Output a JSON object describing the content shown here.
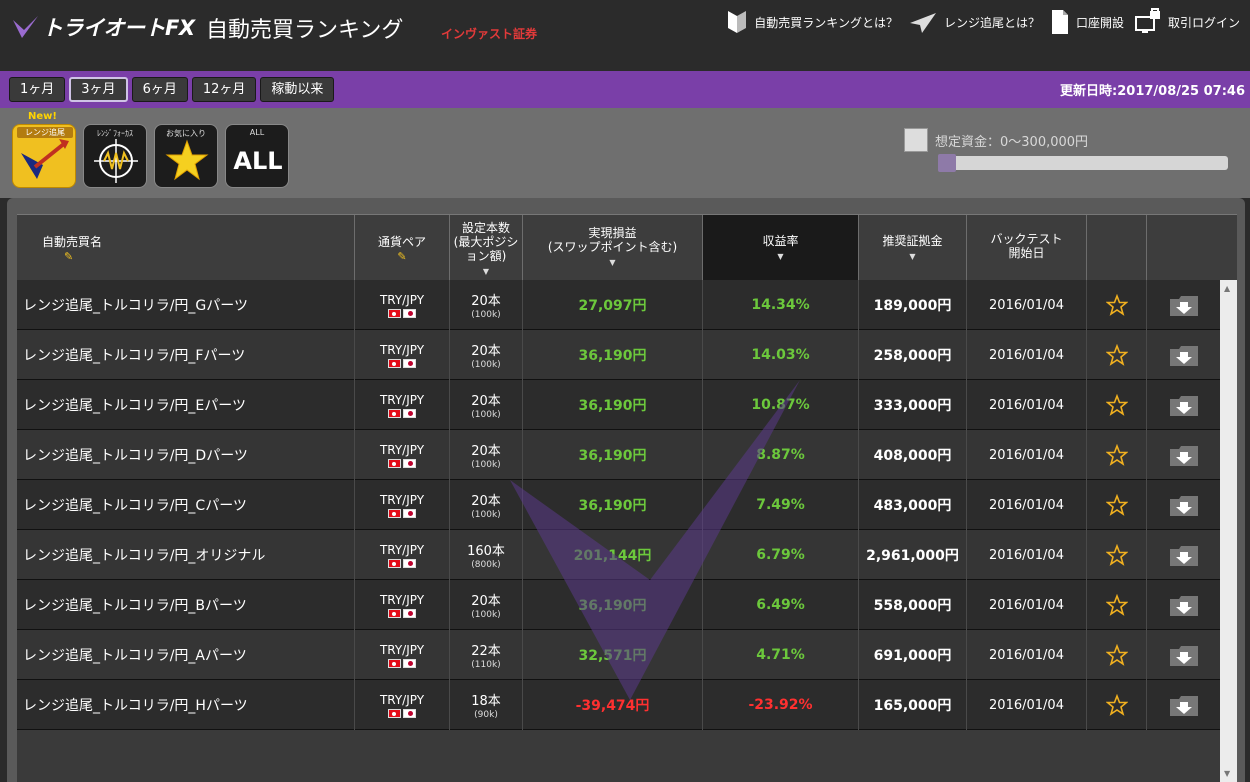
{
  "header": {
    "logo_text": "トライオートFX",
    "title": "自動売買ランキング",
    "broker": "インヴァスト証券",
    "nav": [
      {
        "label": "自動売買ランキングとは？"
      },
      {
        "label": "レンジ追尾とは？"
      },
      {
        "label": "口座開設"
      },
      {
        "label": "取引ログイン"
      }
    ]
  },
  "periods": [
    "1ヶ月",
    "3ヶ月",
    "6ヶ月",
    "12ヶ月",
    "稼動以来"
  ],
  "selected_period": "3ヶ月",
  "updated_at": "更新日時:2017/08/25 07:46",
  "categories": [
    {
      "caption": "レンジ追尾",
      "badge": "New!",
      "icon": "range-trail-icon",
      "active": true
    },
    {
      "caption": "ﾚﾝｼﾞﾌｫｰｶｽ",
      "icon": "range-focus-icon"
    },
    {
      "caption": "お気に入り",
      "icon": "star-icon"
    },
    {
      "caption": "ALL",
      "label": "ALL",
      "icon": "all-icon"
    }
  ],
  "fund_filter": {
    "label": "想定資金：0～300,000円"
  },
  "columns": {
    "name": "自動売買名",
    "pair": "通貨ペア",
    "count_l1": "設定本数",
    "count_l2": "(最大ポジシ",
    "count_l3": "ョン額)",
    "pnl_l1": "実現損益",
    "pnl_l2": "(スワップポイント含む)",
    "rate": "収益率",
    "margin": "推奨証拠金",
    "bt_l1": "バックテスト",
    "bt_l2": "開始日"
  },
  "rows": [
    {
      "name": "レンジ追尾_トルコリラ/円_Gパーツ",
      "pair": "TRY/JPY",
      "count": "20本",
      "max": "(100k)",
      "pnl": "27,097円",
      "rate": "14.34%",
      "margin": "189,000円",
      "date": "2016/01/04",
      "neg": false
    },
    {
      "name": "レンジ追尾_トルコリラ/円_Fパーツ",
      "pair": "TRY/JPY",
      "count": "20本",
      "max": "(100k)",
      "pnl": "36,190円",
      "rate": "14.03%",
      "margin": "258,000円",
      "date": "2016/01/04",
      "neg": false
    },
    {
      "name": "レンジ追尾_トルコリラ/円_Eパーツ",
      "pair": "TRY/JPY",
      "count": "20本",
      "max": "(100k)",
      "pnl": "36,190円",
      "rate": "10.87%",
      "margin": "333,000円",
      "date": "2016/01/04",
      "neg": false
    },
    {
      "name": "レンジ追尾_トルコリラ/円_Dパーツ",
      "pair": "TRY/JPY",
      "count": "20本",
      "max": "(100k)",
      "pnl": "36,190円",
      "rate": "8.87%",
      "margin": "408,000円",
      "date": "2016/01/04",
      "neg": false
    },
    {
      "name": "レンジ追尾_トルコリラ/円_Cパーツ",
      "pair": "TRY/JPY",
      "count": "20本",
      "max": "(100k)",
      "pnl": "36,190円",
      "rate": "7.49%",
      "margin": "483,000円",
      "date": "2016/01/04",
      "neg": false
    },
    {
      "name": "レンジ追尾_トルコリラ/円_オリジナル",
      "pair": "TRY/JPY",
      "count": "160本",
      "max": "(800k)",
      "pnl": "201,144円",
      "rate": "6.79%",
      "margin": "2,961,000円",
      "date": "2016/01/04",
      "neg": false
    },
    {
      "name": "レンジ追尾_トルコリラ/円_Bパーツ",
      "pair": "TRY/JPY",
      "count": "20本",
      "max": "(100k)",
      "pnl": "36,190円",
      "rate": "6.49%",
      "margin": "558,000円",
      "date": "2016/01/04",
      "neg": false
    },
    {
      "name": "レンジ追尾_トルコリラ/円_Aパーツ",
      "pair": "TRY/JPY",
      "count": "22本",
      "max": "(110k)",
      "pnl": "32,571円",
      "rate": "4.71%",
      "margin": "691,000円",
      "date": "2016/01/04",
      "neg": false
    },
    {
      "name": "レンジ追尾_トルコリラ/円_Hパーツ",
      "pair": "TRY/JPY",
      "count": "18本",
      "max": "(90k)",
      "pnl": "-39,474円",
      "rate": "-23.92%",
      "margin": "165,000円",
      "date": "2016/01/04",
      "neg": true
    }
  ],
  "colors": {
    "accent_purple": "#7a3fa8",
    "positive": "#6cc83c",
    "negative": "#ff3030",
    "favorite_star": "#f0b020"
  }
}
